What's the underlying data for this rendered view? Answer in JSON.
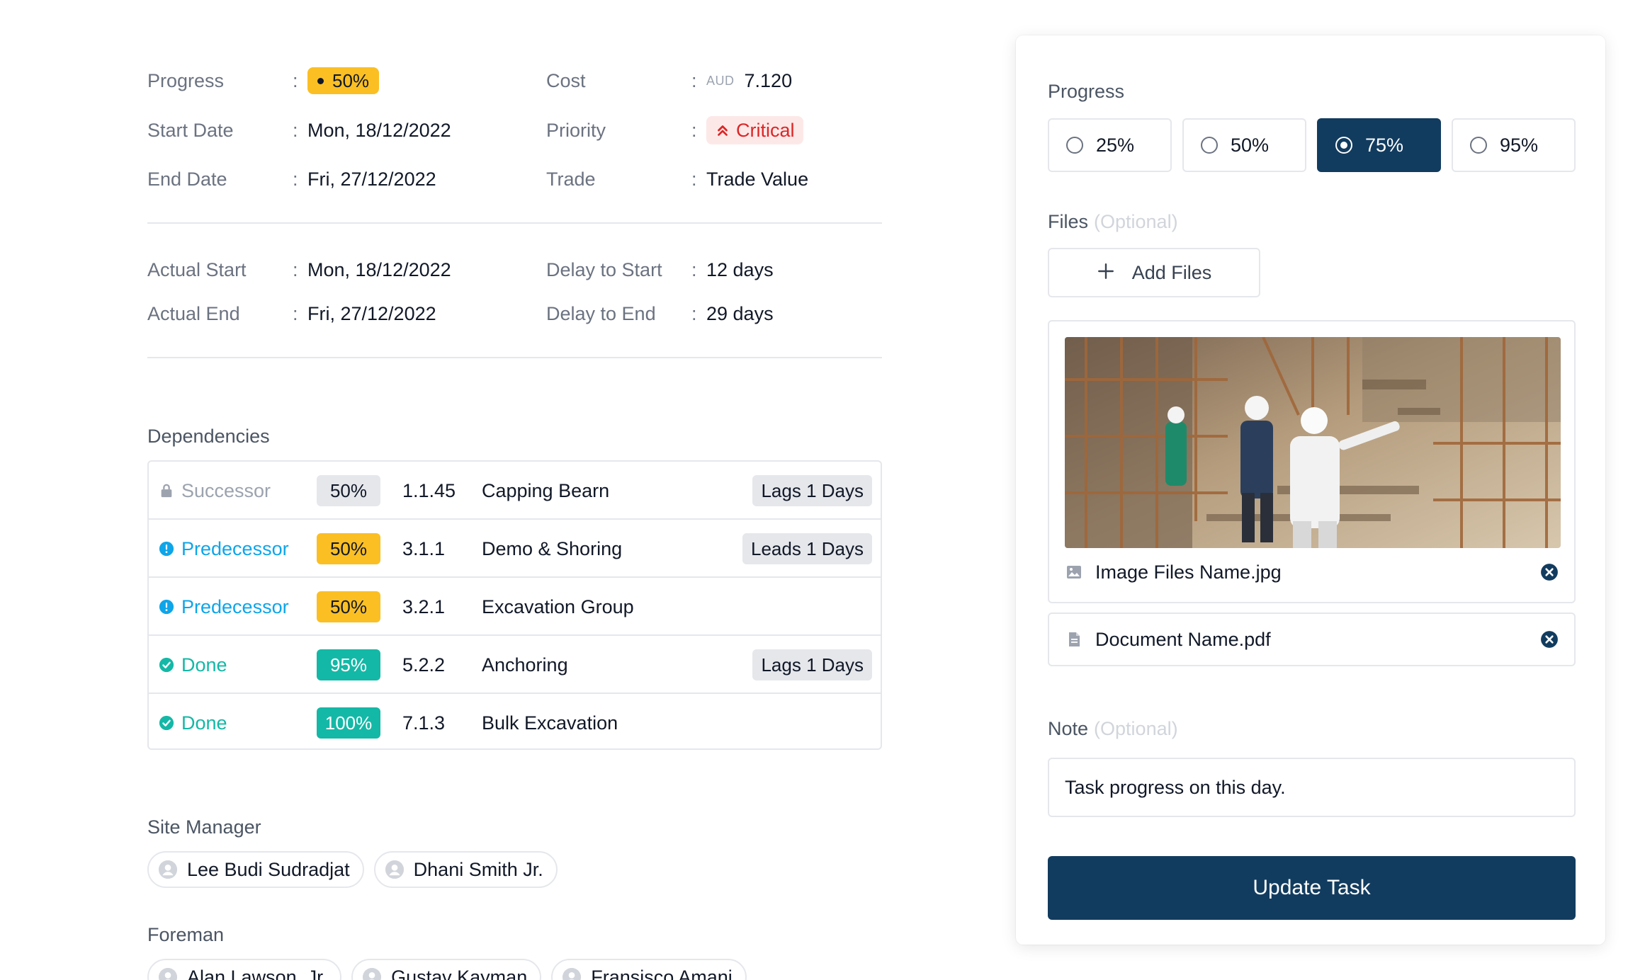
{
  "details": {
    "progress": {
      "label": "Progress",
      "value": "50%"
    },
    "cost": {
      "label": "Cost",
      "currency": "AUD",
      "value": "7.120"
    },
    "start_date": {
      "label": "Start Date",
      "value": "Mon, 18/12/2022"
    },
    "priority": {
      "label": "Priority",
      "value": "Critical"
    },
    "end_date": {
      "label": "End Date",
      "value": "Fri, 27/12/2022"
    },
    "trade": {
      "label": "Trade",
      "value": "Trade Value"
    },
    "actual_start": {
      "label": "Actual Start",
      "value": "Mon, 18/12/2022"
    },
    "delay_start": {
      "label": "Delay to Start",
      "value": "12 days"
    },
    "actual_end": {
      "label": "Actual End",
      "value": "Fri, 27/12/2022"
    },
    "delay_end": {
      "label": "Delay to End",
      "value": "29 days"
    },
    "colon": ":"
  },
  "dependencies": {
    "title": "Dependencies",
    "rows": [
      {
        "status": "Successor",
        "status_type": "locked",
        "percent": "50%",
        "code": "1.1.45",
        "name": "Capping Bearn",
        "lag": "Lags 1 Days"
      },
      {
        "status": "Predecessor",
        "status_type": "info",
        "percent": "50%",
        "code": "3.1.1",
        "name": "Demo & Shoring",
        "lag": "Leads 1 Days"
      },
      {
        "status": "Predecessor",
        "status_type": "info",
        "percent": "50%",
        "code": "3.2.1",
        "name": "Excavation Group",
        "lag": ""
      },
      {
        "status": "Done",
        "status_type": "done",
        "percent": "95%",
        "code": "5.2.2",
        "name": "Anchoring",
        "lag": "Lags 1 Days"
      },
      {
        "status": "Done",
        "status_type": "done",
        "percent": "100%",
        "code": "7.1.3",
        "name": "Bulk Excavation",
        "lag": ""
      }
    ]
  },
  "site_manager": {
    "title": "Site Manager",
    "people": [
      "Lee Budi Sudradjat",
      "Dhani Smith Jr."
    ]
  },
  "foreman": {
    "title": "Foreman",
    "people": [
      "Alan Lawson, Jr.",
      "Gustav Kayman",
      "Fransisco Amani"
    ]
  },
  "panel": {
    "progress_label": "Progress",
    "progress_options": [
      "25%",
      "50%",
      "75%",
      "95%"
    ],
    "progress_selected": "75%",
    "files_label": "Files",
    "optional_text": "(Optional)",
    "add_files_label": "Add Files",
    "image_file_name": "Image Files Name.jpg",
    "document_file_name": "Document Name.pdf",
    "note_label": "Note",
    "note_value": "Task progress on this day.",
    "update_button": "Update Task"
  },
  "colors": {
    "primary": "#123c5f",
    "progress_yellow": "#fbbf24",
    "critical_red": "#dc2626",
    "info_blue": "#0ea5e9",
    "done_teal": "#14b8a6"
  },
  "icons": {
    "lock": "lock-icon",
    "info": "info-circle-icon",
    "done": "check-circle-icon",
    "priority": "double-chevron-up-icon",
    "image": "image-icon",
    "document": "document-icon",
    "close": "close-circle-icon",
    "add": "plus-icon",
    "avatar": "user-avatar-icon"
  }
}
